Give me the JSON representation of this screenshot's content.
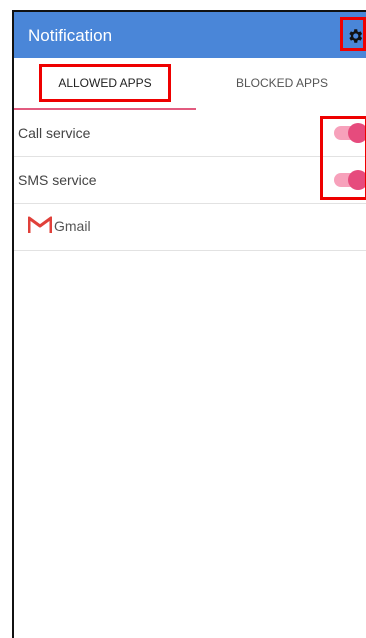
{
  "appbar": {
    "title": "Notification",
    "settings_icon": "gear-icon"
  },
  "tabs": [
    {
      "label": "ALLOWED APPS",
      "selected": true
    },
    {
      "label": "BLOCKED APPS",
      "selected": false
    }
  ],
  "services": [
    {
      "label": "Call service",
      "enabled": true
    },
    {
      "label": "SMS service",
      "enabled": true
    }
  ],
  "apps": [
    {
      "label": "Gmail",
      "icon": "gmail-icon"
    }
  ],
  "colors": {
    "appbar": "#4a86d8",
    "accent": "#e64b7d",
    "highlight": "#e00000"
  }
}
